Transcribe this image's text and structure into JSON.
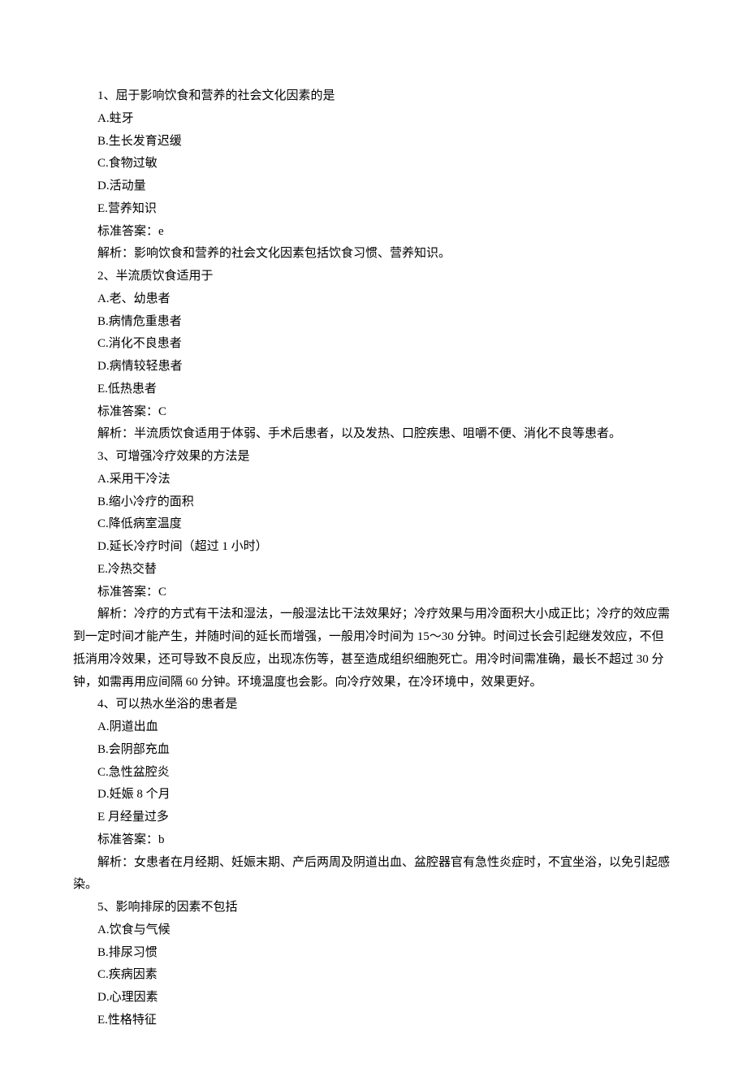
{
  "questions": [
    {
      "number": "1、",
      "stem": "屈于影响饮食和营养的社会文化因素的是",
      "options": [
        "A.蛀牙",
        "B.生长发育迟缓",
        "C.食物过敏",
        "D.活动量",
        "E.营养知识"
      ],
      "answer_label": "标准答案：",
      "answer_value": "e",
      "explanation": [
        "解析：影响饮食和营养的社会文化因素包括饮食习惯、营养知识。"
      ]
    },
    {
      "number": "2、",
      "stem": "半流质饮食适用于",
      "options": [
        "A.老、幼患者",
        "B.病情危重患者",
        "C.消化不良患者",
        "D.病情较轻患者",
        "E.低热患者"
      ],
      "answer_label": "标准答案：",
      "answer_value": "C",
      "explanation": [
        "解析：半流质饮食适用于体弱、手术后患者，以及发热、口腔疾患、咀嚼不便、消化不良等患者。"
      ]
    },
    {
      "number": "3、",
      "stem": "可增强冷疗效果的方法是",
      "options": [
        "A.采用干冷法",
        "B.缩小冷疗的面积",
        "C.降低病室温度",
        "D.延长冷疗时间（超过 1 小时）",
        "E.冷热交替"
      ],
      "answer_label": "标准答案：",
      "answer_value": "C",
      "explanation": [
        "解析：冷疗的方式有干法和湿法，一般湿法比干法效果好；冷疗效果与用冷面积大小成正比；冷疗的效应需到一定时间才能产生，并随时间的延长而增强，一般用冷时间为 15～30 分钟。时间过长会引起继发效应，不但抵消用冷效果，还可导致不良反应，出现冻伤等，甚至造成组织细胞死亡。用冷时间需准确，最长不超过 30 分钟，如需再用应间隔 60 分钟。环境温度也会影。向冷疗效果，在冷环境中，效果更好。"
      ]
    },
    {
      "number": "4、",
      "stem": "可以热水坐浴的患者是",
      "options": [
        "A.阴道出血",
        "B.会阴部充血",
        "C.急性盆腔炎",
        "D.妊娠 8 个月",
        "E 月经量过多"
      ],
      "answer_label": "标准答案：",
      "answer_value": "b",
      "explanation": [
        "解析：女患者在月经期、妊娠末期、产后两周及阴道出血、盆腔器官有急性炎症时，不宜坐浴，以免引起感染。"
      ]
    },
    {
      "number": "5、",
      "stem": "影响排尿的因素不包括",
      "options": [
        "A.饮食与气候",
        "B.排尿习惯",
        "C.疾病因素",
        "D.心理因素",
        "E.性格特征"
      ],
      "answer_label": "",
      "answer_value": "",
      "explanation": []
    }
  ]
}
